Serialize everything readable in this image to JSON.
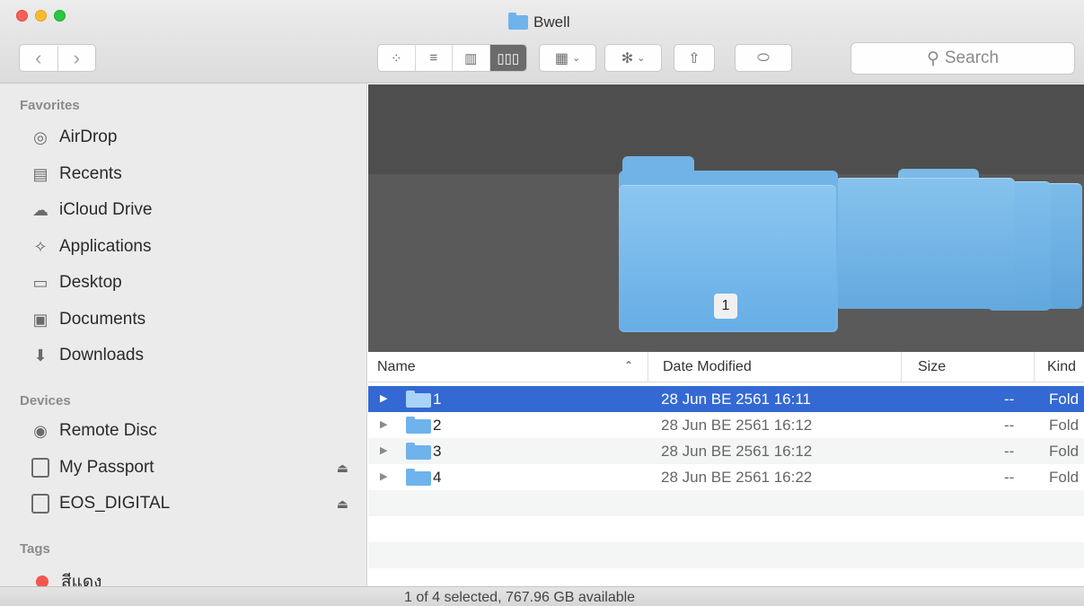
{
  "window": {
    "title": "Bwell",
    "controls": [
      "close",
      "minimize",
      "zoom"
    ]
  },
  "toolbar": {
    "back_icon": "chevron-left-icon",
    "forward_icon": "chevron-right-icon",
    "back_glyph": "‹",
    "forward_glyph": "›",
    "views": [
      {
        "name": "icon-view",
        "glyph": "⁘",
        "active": false
      },
      {
        "name": "list-view",
        "glyph": "≡",
        "active": false
      },
      {
        "name": "column-view",
        "glyph": "▥",
        "active": false
      },
      {
        "name": "cover-flow-view",
        "glyph": "▯▯▯",
        "active": true
      }
    ],
    "arrange_glyph": "▦",
    "action_glyph": "✻",
    "chevron_glyph": "⌄",
    "share_glyph": "⇧",
    "tag_glyph": "⬭",
    "search_placeholder": "Search",
    "search_glyph": "⚲"
  },
  "sidebar": {
    "favorites_heading": "Favorites",
    "favorites": [
      {
        "label": "AirDrop",
        "icon": "airdrop-icon",
        "glyph": "◎"
      },
      {
        "label": "Recents",
        "icon": "recents-icon",
        "glyph": "▤"
      },
      {
        "label": "iCloud Drive",
        "icon": "cloud-icon",
        "glyph": "☁"
      },
      {
        "label": "Applications",
        "icon": "applications-icon",
        "glyph": "✧"
      },
      {
        "label": "Desktop",
        "icon": "desktop-icon",
        "glyph": "▭"
      },
      {
        "label": "Documents",
        "icon": "documents-icon",
        "glyph": "▣"
      },
      {
        "label": "Downloads",
        "icon": "downloads-icon",
        "glyph": "⬇"
      }
    ],
    "devices_heading": "Devices",
    "devices": [
      {
        "label": "Remote Disc",
        "icon": "disc-icon",
        "eject": false
      },
      {
        "label": "My Passport",
        "icon": "drive-icon",
        "eject": true
      },
      {
        "label": "EOS_DIGITAL",
        "icon": "drive-icon",
        "eject": true
      }
    ],
    "eject_glyph": "⏏",
    "tags_heading": "Tags",
    "tags": [
      {
        "label": "สีแดง",
        "color": "#f0584f"
      }
    ]
  },
  "coverflow": {
    "selected_label": "1",
    "folder_color": "#71b3e6",
    "background": "#5a5a5a"
  },
  "list": {
    "columns": {
      "name": "Name",
      "date": "Date Modified",
      "size": "Size",
      "kind": "Kind"
    },
    "sort_glyph": "⌃",
    "rows": [
      {
        "name": "1",
        "date": "28 Jun BE 2561 16:11",
        "size": "--",
        "kind": "Fold",
        "selected": true
      },
      {
        "name": "2",
        "date": "28 Jun BE 2561 16:12",
        "size": "--",
        "kind": "Fold",
        "selected": false
      },
      {
        "name": "3",
        "date": "28 Jun BE 2561 16:12",
        "size": "--",
        "kind": "Fold",
        "selected": false
      },
      {
        "name": "4",
        "date": "28 Jun BE 2561 16:22",
        "size": "--",
        "kind": "Fold",
        "selected": false
      }
    ],
    "disclosure_glyph": "▶",
    "selection_color": "#3469d3"
  },
  "status": {
    "text": "1 of 4 selected, 767.96 GB available"
  }
}
